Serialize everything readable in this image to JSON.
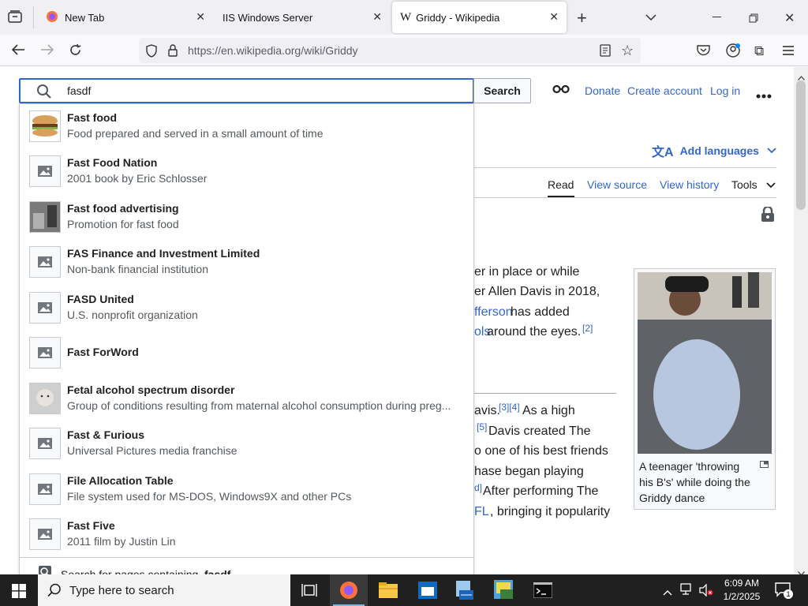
{
  "browser": {
    "tabs": [
      {
        "title": "New Tab"
      },
      {
        "title": "IIS Windows Server"
      },
      {
        "title": "Griddy - Wikipedia"
      }
    ],
    "url": "https://en.wikipedia.org/wiki/Griddy"
  },
  "wiki": {
    "search_value": "fasdf",
    "search_button": "Search",
    "donate": "Donate",
    "create_account": "Create account",
    "log_in": "Log in",
    "add_languages": "Add languages",
    "tabs": [
      "Read",
      "View source",
      "View history",
      "Tools"
    ],
    "body_lines_1": [
      "er in place or while",
      "er Allen Davis in 2018,",
      "fferson",
      " has added",
      "ols",
      " around the eyes.",
      "[2]"
    ],
    "body_lines_2": [
      "avis.",
      "[3][4]",
      " As a high",
      "[5]",
      " Davis created The",
      "o one of his best friends",
      "hase began playing",
      "d]",
      " After performing The",
      "FL",
      ", bringing it popularity"
    ],
    "caption": [
      "A teenager 'throwing",
      "his B's' while doing the",
      "Griddy dance"
    ],
    "suggestions": [
      {
        "title": "Fast food",
        "desc": "Food prepared and served in a small amount of time"
      },
      {
        "title": "Fast Food Nation",
        "desc": "2001 book by Eric Schlosser"
      },
      {
        "title": "Fast food advertising",
        "desc": "Promotion for fast food"
      },
      {
        "title": "FAS Finance and Investment Limited",
        "desc": "Non-bank financial institution"
      },
      {
        "title": "FASD United",
        "desc": "U.S. nonprofit organization"
      },
      {
        "title": "Fast ForWord",
        "desc": ""
      },
      {
        "title": "Fetal alcohol spectrum disorder",
        "desc": "Group of conditions resulting from maternal alcohol consumption during preg..."
      },
      {
        "title": "Fast & Furious",
        "desc": "Universal Pictures media franchise"
      },
      {
        "title": "File Allocation Table",
        "desc": "File system used for MS-DOS, Windows9X and other PCs"
      },
      {
        "title": "Fast Five",
        "desc": "2011 film by Justin Lin"
      }
    ],
    "search_containing_prefix": "Search for pages containing ",
    "search_containing_term": "fasdf"
  },
  "taskbar": {
    "search_placeholder": "Type here to search",
    "time": "6:09 AM",
    "date": "1/2/2025",
    "notification_count": "1"
  }
}
